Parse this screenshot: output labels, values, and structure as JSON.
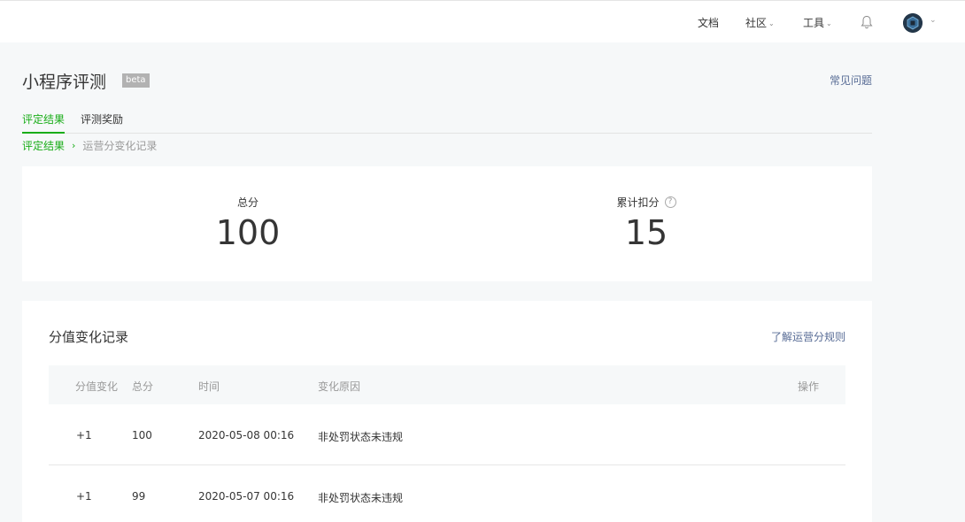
{
  "nav": {
    "docs": "文档",
    "community": "社区",
    "tools": "工具"
  },
  "page": {
    "title": "小程序评测",
    "badge": "beta",
    "faq": "常见问题"
  },
  "tabs": [
    {
      "label": "评定结果",
      "active": true
    },
    {
      "label": "评测奖励",
      "active": false
    }
  ],
  "breadcrumb": {
    "parent": "评定结果",
    "separator": "›",
    "current": "运营分变化记录"
  },
  "scores": {
    "total_label": "总分",
    "total_value": "100",
    "deduct_label": "累计扣分",
    "deduct_value": "15",
    "help_glyph": "?"
  },
  "records": {
    "title": "分值变化记录",
    "rules_link": "了解运营分规则",
    "columns": [
      "分值变化",
      "总分",
      "时间",
      "变化原因",
      "操作"
    ],
    "rows": [
      [
        "+1",
        "100",
        "2020-05-08 00:16",
        "非处罚状态未违规",
        ""
      ],
      [
        "+1",
        "99",
        "2020-05-07 00:16",
        "非处罚状态未违规",
        ""
      ]
    ]
  },
  "colors": {
    "accent": "#1aad19",
    "link": "#576b95",
    "background": "#f6f8f9"
  }
}
